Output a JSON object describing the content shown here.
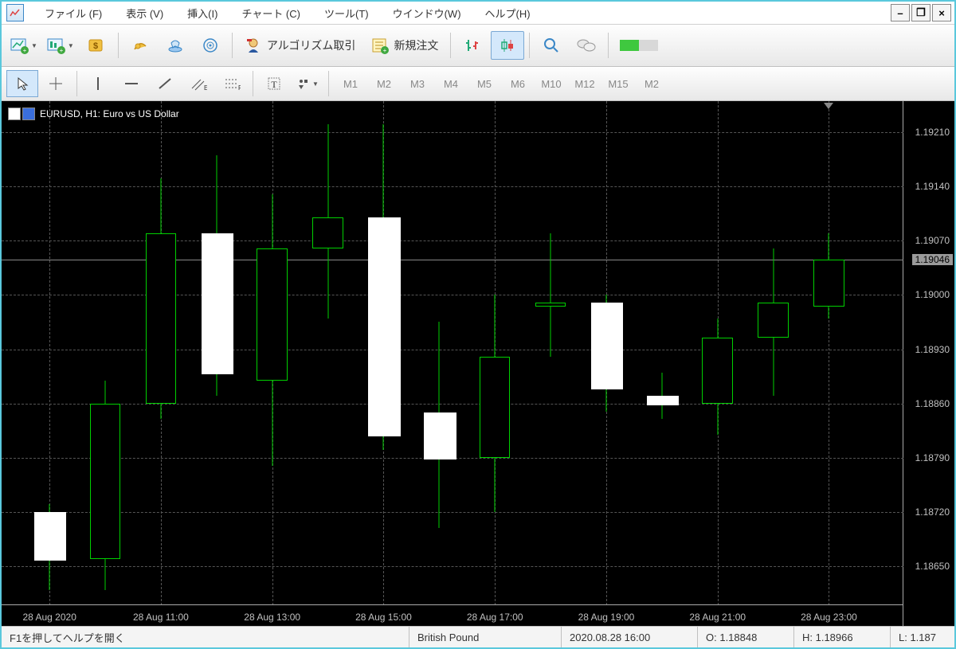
{
  "menu": {
    "file": "ファイル (F)",
    "view": "表示 (V)",
    "insert": "挿入(I)",
    "chart": "チャート (C)",
    "tool": "ツール(T)",
    "window": "ウインドウ(W)",
    "help": "ヘルプ(H)"
  },
  "toolbar": {
    "algo": "アルゴリズム取引",
    "neworder": "新規注文"
  },
  "timeframes": [
    "M1",
    "M2",
    "M3",
    "M4",
    "M5",
    "M6",
    "M10",
    "M12",
    "M15",
    "M2"
  ],
  "chart": {
    "title": "EURUSD, H1:  Euro vs US Dollar"
  },
  "yaxis": {
    "labels": [
      "1.19210",
      "1.19140",
      "1.19070",
      "1.19000",
      "1.18930",
      "1.18860",
      "1.18790",
      "1.18720",
      "1.18650"
    ],
    "current": "1.19046"
  },
  "xaxis": {
    "labels": [
      "28 Aug 2020",
      "28 Aug 11:00",
      "28 Aug 13:00",
      "28 Aug 15:00",
      "28 Aug 17:00",
      "28 Aug 19:00",
      "28 Aug 21:00",
      "28 Aug 23:00"
    ]
  },
  "status": {
    "help": "F1を押してヘルプを開く",
    "symbol": "British Pound",
    "datetime": "2020.08.28 16:00",
    "open": "O: 1.18848",
    "high": "H: 1.18966",
    "low": "L: 1.187"
  },
  "chart_data": {
    "type": "candlestick",
    "symbol": "EURUSD",
    "timeframe": "H1",
    "ylim": [
      1.186,
      1.1925
    ],
    "candles": [
      {
        "t": "28 Aug 09:00",
        "o": 1.1866,
        "h": 1.1873,
        "l": 1.1862,
        "c": 1.1872,
        "dir": "down"
      },
      {
        "t": "28 Aug 10:00",
        "o": 1.1886,
        "h": 1.1889,
        "l": 1.1862,
        "c": 1.1866,
        "dir": "up"
      },
      {
        "t": "28 Aug 11:00",
        "o": 1.1886,
        "h": 1.1915,
        "l": 1.1884,
        "c": 1.1908,
        "dir": "up"
      },
      {
        "t": "28 Aug 12:00",
        "o": 1.1908,
        "h": 1.1918,
        "l": 1.1887,
        "c": 1.189,
        "dir": "down"
      },
      {
        "t": "28 Aug 13:00",
        "o": 1.1889,
        "h": 1.1913,
        "l": 1.1878,
        "c": 1.1906,
        "dir": "up"
      },
      {
        "t": "28 Aug 14:00",
        "o": 1.1906,
        "h": 1.1922,
        "l": 1.1897,
        "c": 1.191,
        "dir": "up"
      },
      {
        "t": "28 Aug 15:00",
        "o": 1.191,
        "h": 1.1922,
        "l": 1.188,
        "c": 1.1882,
        "dir": "down"
      },
      {
        "t": "28 Aug 16:00",
        "o": 1.18848,
        "h": 1.18966,
        "l": 1.187,
        "c": 1.1879,
        "dir": "down"
      },
      {
        "t": "28 Aug 17:00",
        "o": 1.1879,
        "h": 1.19,
        "l": 1.1872,
        "c": 1.1892,
        "dir": "up"
      },
      {
        "t": "28 Aug 18:00",
        "o": 1.18985,
        "h": 1.1908,
        "l": 1.1892,
        "c": 1.1899,
        "dir": "up"
      },
      {
        "t": "28 Aug 19:00",
        "o": 1.1899,
        "h": 1.19,
        "l": 1.1885,
        "c": 1.1888,
        "dir": "down"
      },
      {
        "t": "28 Aug 20:00",
        "o": 1.1887,
        "h": 1.189,
        "l": 1.1884,
        "c": 1.1886,
        "dir": "down"
      },
      {
        "t": "28 Aug 21:00",
        "o": 1.1886,
        "h": 1.1897,
        "l": 1.1882,
        "c": 1.18945,
        "dir": "up"
      },
      {
        "t": "28 Aug 22:00",
        "o": 1.18945,
        "h": 1.1906,
        "l": 1.1887,
        "c": 1.1899,
        "dir": "up"
      },
      {
        "t": "28 Aug 23:00",
        "o": 1.18985,
        "h": 1.1908,
        "l": 1.1897,
        "c": 1.19046,
        "dir": "up"
      }
    ]
  }
}
